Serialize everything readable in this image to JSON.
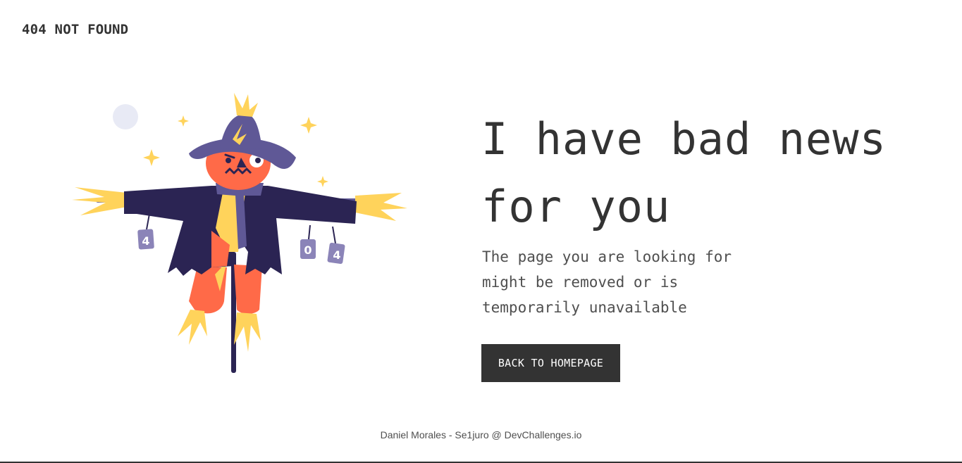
{
  "header": {
    "logo_text": "404 NOT FOUND"
  },
  "illustration": {
    "subject": "scarecrow",
    "can_labels": [
      "4",
      "0",
      "4"
    ]
  },
  "main": {
    "headline": "I have bad news for you",
    "description": "The page you are looking for might be removed or is temporarily unavailable",
    "button_label": "BACK TO HOMEPAGE"
  },
  "footer": {
    "credit": "Daniel Morales - Se1juro @ DevChallenges.io"
  },
  "colors": {
    "text": "#333333",
    "body_text": "#4f4f4f",
    "button_bg": "#333333",
    "button_text": "#ffffff",
    "coat": "#2b2453",
    "hat": "#5f5896",
    "face": "#ff6a48",
    "straw": "#ffd35b",
    "moon": "#e8eaf5"
  }
}
